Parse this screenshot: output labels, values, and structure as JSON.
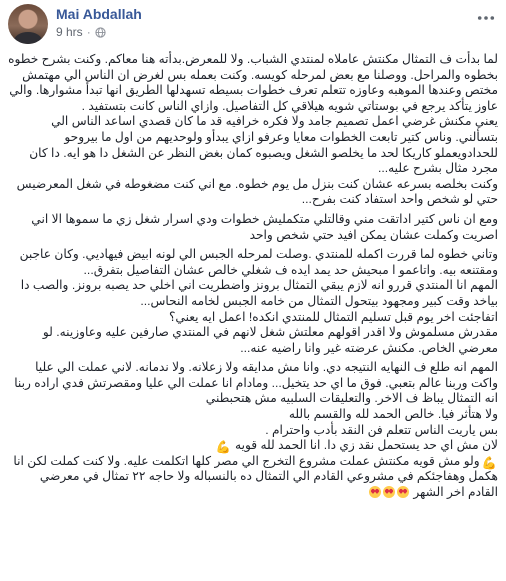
{
  "post": {
    "author": "Mai Abdallah",
    "time": "9 hrs",
    "separator": "·",
    "privacy_icon": "globe-icon",
    "menu_icon": "more-horizontal-icon",
    "body": [
      "لما بدأت ف التمثال مكنتش عاملاه لمنتدي الشباب. ولا للمعرض.بدأته هنا معاكم. وكنت بشرح خطوه بخطوه والمراحل. ووصلنا مع بعض لمرحله كويسه. وكنت بعمله بس لغرض ان الناس الي مهتمش مختص وعندها الموهبه وعاوزه تتعلم تعرف خطوات بسيطه تسهدلها الطريق انها تبدأ مشوارها. والي عاوز يتأكد يرجع في بوستاتي شويه هيلاقي كل التفاصيل. وازاي الناس كانت بتستفيد .",
      "يعني مكنش غرضي اعمل تصميم جامد ولا فكره خرافيه قد ما كان قصدي اساعد الناس الي بتسألني. وناس كتير تابعت الخطوات معايا وعرفو ازاي يبدأو ولوحديهم من اول ما بيروحو للحدادويعملو كاريكا لحد ما يخلصو الشغل ويصبوه كمان بغض النظر عن الشغل دا هو ايه. دا كان مجرد مثال بشرح عليه...",
      "وكنت بخلصه بسرعه عشان كنت بنزل مل يوم خطوه. مع اني كنت مضغوطه في شغل المعرضيس حتي لو شخص واحد استفاد كنت بفرح...",
      "ومع ان ناس كتير اداتقت مني وقالتلي متكمليش خطوات ودي اسرار شغل زي ما سموها الا اني اصريت وكملت عشان يمكن افيد حتي شخص واحد",
      "وتاني خطوه لما قررت اكمله للمنتدي .وصلت لمرحله الجبس الي لونه ابيض فيهاديي. وكان عاجبن ومقتنعه بيه. واتاعمو ا مبحيش حد يمد ايده ف شغلي خالص عشان التفاصيل بتفرق...",
      "المهم انا المنتدي قررو انه لازم يبقي التمثال برونز واضطريت اني اخلي حد يصبه برونز. والصب دا بياخد وقت كبير ومجهود بيتحول التمثال من خامه الجبس لخامه النحاس...",
      "اتفاجئت اخر يوم قبل تسليم التمثال للمنتدي انكده! اعمل ايه يعني؟",
      "مقدرش مسلموش ولا اقدر اقولهم معلتش شغل لانهم في المنتدي صارفين عليه وعاوزينه. لو معرضي الخاص. مكنش عرضته غير وانا راضيه عنه...",
      "المهم انه طلع ف النهايه النتيجه دي. وانا مش مدايقه ولا زعلانه. ولا ندمانه. لاني عملت الي عليا واكت وربنا عالم بتعبي. فوق ما اي حد يتخيل... ومادام انا عملت الي عليا ومقصرتش فدي اراده ربنا انه التمثال يباظ ف الاخر. والتعليقات السلبيه مش هتحبطني",
      "ولا هتأثر فيا. خالص الحمد لله والقسم بالله",
      "بس ياريت الناس تتعلم فن النقد بأدب واحترام .",
      "لان مش اي حد يستحمل نقد زي دا. انا الحمد لله قويه",
      "ولو مش قويه مكنتش عملت مشروع التخرج الي مصر كلها اتكلمت عليه. ولا كنت كملت لكن انا هكمل وهفاجئكم في مشروعي القادم الي التمثال ده بالنسباله ولا حاجه ٢٢ تمثال في معرضي القادم اخر الشهر"
    ]
  },
  "colors": {
    "name": "#385898",
    "text": "#1d2129",
    "meta": "#616770"
  }
}
